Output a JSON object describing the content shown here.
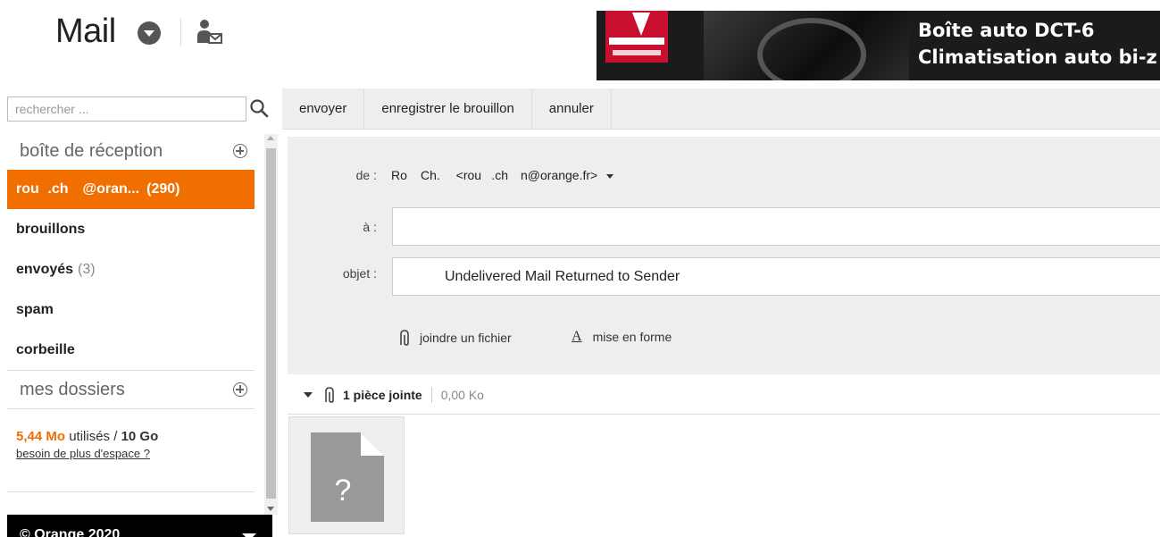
{
  "header": {
    "app_title": "Mail",
    "menu_icon": "caret-down-circle-icon",
    "contacts_icon": "contacts-mail-icon"
  },
  "ad": {
    "line1": "Boîte auto DCT-6",
    "line2": "Climatisation auto bi-z"
  },
  "search": {
    "placeholder": "rechercher ...",
    "icon": "search-icon"
  },
  "toolbar": {
    "send_label": "envoyer",
    "save_draft_label": "enregistrer le brouillon",
    "cancel_label": "annuler"
  },
  "sidebar": {
    "inbox_title": "boîte de réception",
    "account": {
      "label": "rou   .ch     @oran...",
      "count": "(290)"
    },
    "items": [
      {
        "label": "brouillons",
        "count": ""
      },
      {
        "label": "envoyés",
        "count": "(3)"
      },
      {
        "label": "spam",
        "count": ""
      },
      {
        "label": "corbeille",
        "count": ""
      }
    ],
    "folders_title": "mes dossiers",
    "storage": {
      "used": "5,44 Mo",
      "used_suffix": "utilisés /",
      "total": "10 Go",
      "more_space_link": "besoin de plus d'espace ?"
    },
    "footer": "© Orange 2020"
  },
  "compose": {
    "from_label": "de :",
    "from_value": "Ro     Ch.      <rou    .ch     n@orange.fr>",
    "to_label": "à :",
    "to_value": "",
    "subject_label": "objet :",
    "subject_value": "Undelivered Mail Returned to Sender",
    "attach_file_label": "joindre un fichier",
    "format_label": "mise en forme",
    "format_icon_glyph": "A"
  },
  "attachments": {
    "count_label": "1 pièce jointe",
    "size": "0,00 Ko",
    "file_glyph": "?"
  },
  "colors": {
    "accent": "#f16e00",
    "panel_bg": "#eeeeee",
    "footer_bg": "#000000"
  }
}
